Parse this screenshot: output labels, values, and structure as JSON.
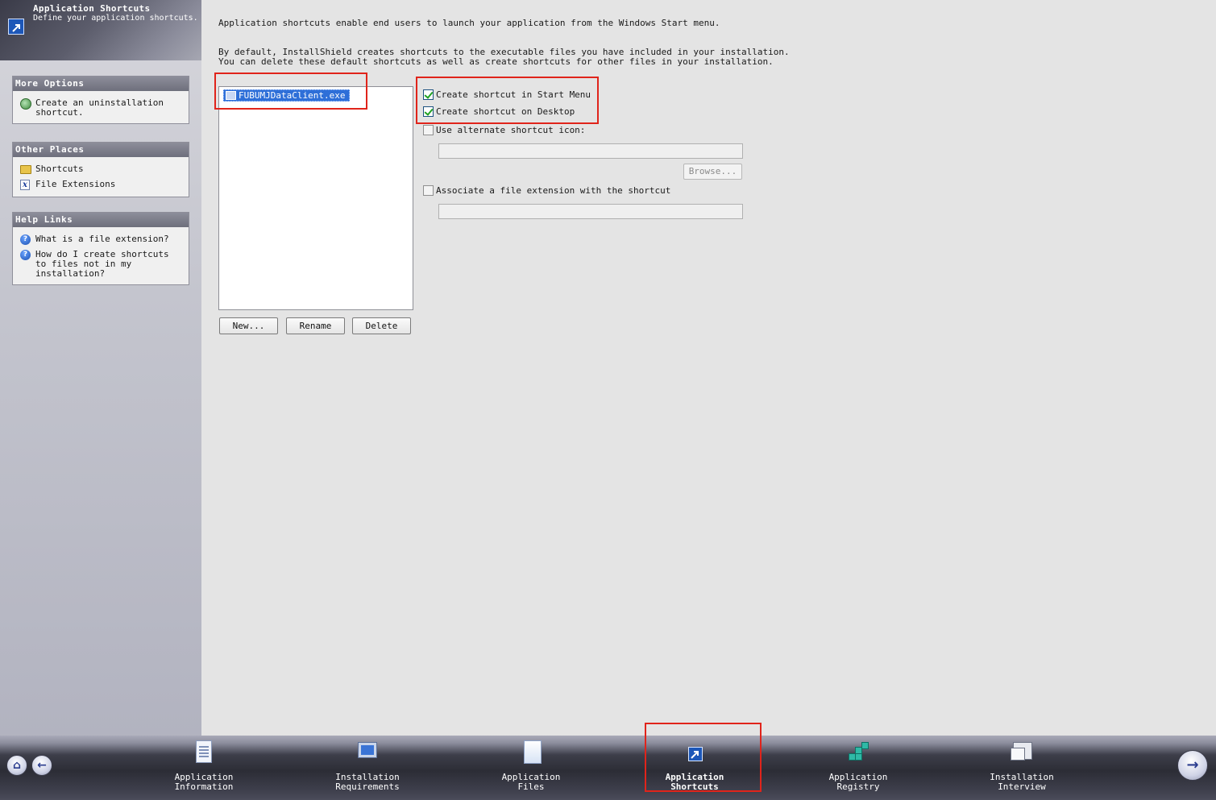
{
  "header": {
    "title": "Application Shortcuts",
    "subtitle": "Define your application shortcuts."
  },
  "sidebar": {
    "more_options": {
      "title": "More Options",
      "items": [
        {
          "label": "Create an uninstallation shortcut.",
          "icon": "uninstall-shortcut-icon"
        }
      ]
    },
    "other_places": {
      "title": "Other Places",
      "items": [
        {
          "label": "Shortcuts",
          "icon": "folder-icon"
        },
        {
          "label": "File Extensions",
          "icon": "file-extension-icon"
        }
      ]
    },
    "help_links": {
      "title": "Help Links",
      "items": [
        {
          "label": "What is a file extension?",
          "icon": "help-icon"
        },
        {
          "label": "How do I create shortcuts to files not in my installation?",
          "icon": "help-icon"
        }
      ]
    }
  },
  "main": {
    "description1": "Application shortcuts enable end users to launch your application from the Windows Start menu.",
    "description2": "By default, InstallShield creates shortcuts to the executable files you have included in your installation.\nYou can delete these default shortcuts as well as create shortcuts for other files in your installation.",
    "shortcuts": [
      {
        "label": "FUBUMJDataClient.exe",
        "selected": true
      }
    ],
    "buttons": {
      "new": "New...",
      "rename": "Rename",
      "delete": "Delete",
      "browse": "Browse..."
    },
    "options": {
      "start_menu": {
        "label": "Create shortcut in Start Menu",
        "checked": true
      },
      "desktop": {
        "label": "Create shortcut on Desktop",
        "checked": true
      },
      "alt_icon": {
        "label": "Use alternate shortcut icon:",
        "checked": false,
        "value": ""
      },
      "file_ext": {
        "label": "Associate a file extension with the shortcut",
        "checked": false,
        "value": ""
      }
    },
    "highlight_color": "#e0241b",
    "selection_color": "#2e6fd8"
  },
  "navbar": {
    "steps": [
      {
        "label": "Application\nInformation",
        "icon": "application-information-icon",
        "active": false
      },
      {
        "label": "Installation\nRequirements",
        "icon": "installation-requirements-icon",
        "active": false
      },
      {
        "label": "Application\nFiles",
        "icon": "application-files-icon",
        "active": false
      },
      {
        "label": "Application\nShortcuts",
        "icon": "application-shortcuts-icon",
        "active": true
      },
      {
        "label": "Application\nRegistry",
        "icon": "application-registry-icon",
        "active": false
      },
      {
        "label": "Installation\nInterview",
        "icon": "installation-interview-icon",
        "active": false
      }
    ],
    "home_icon": "home-icon",
    "back_icon": "back-arrow-icon",
    "next_icon": "next-arrow-icon"
  }
}
